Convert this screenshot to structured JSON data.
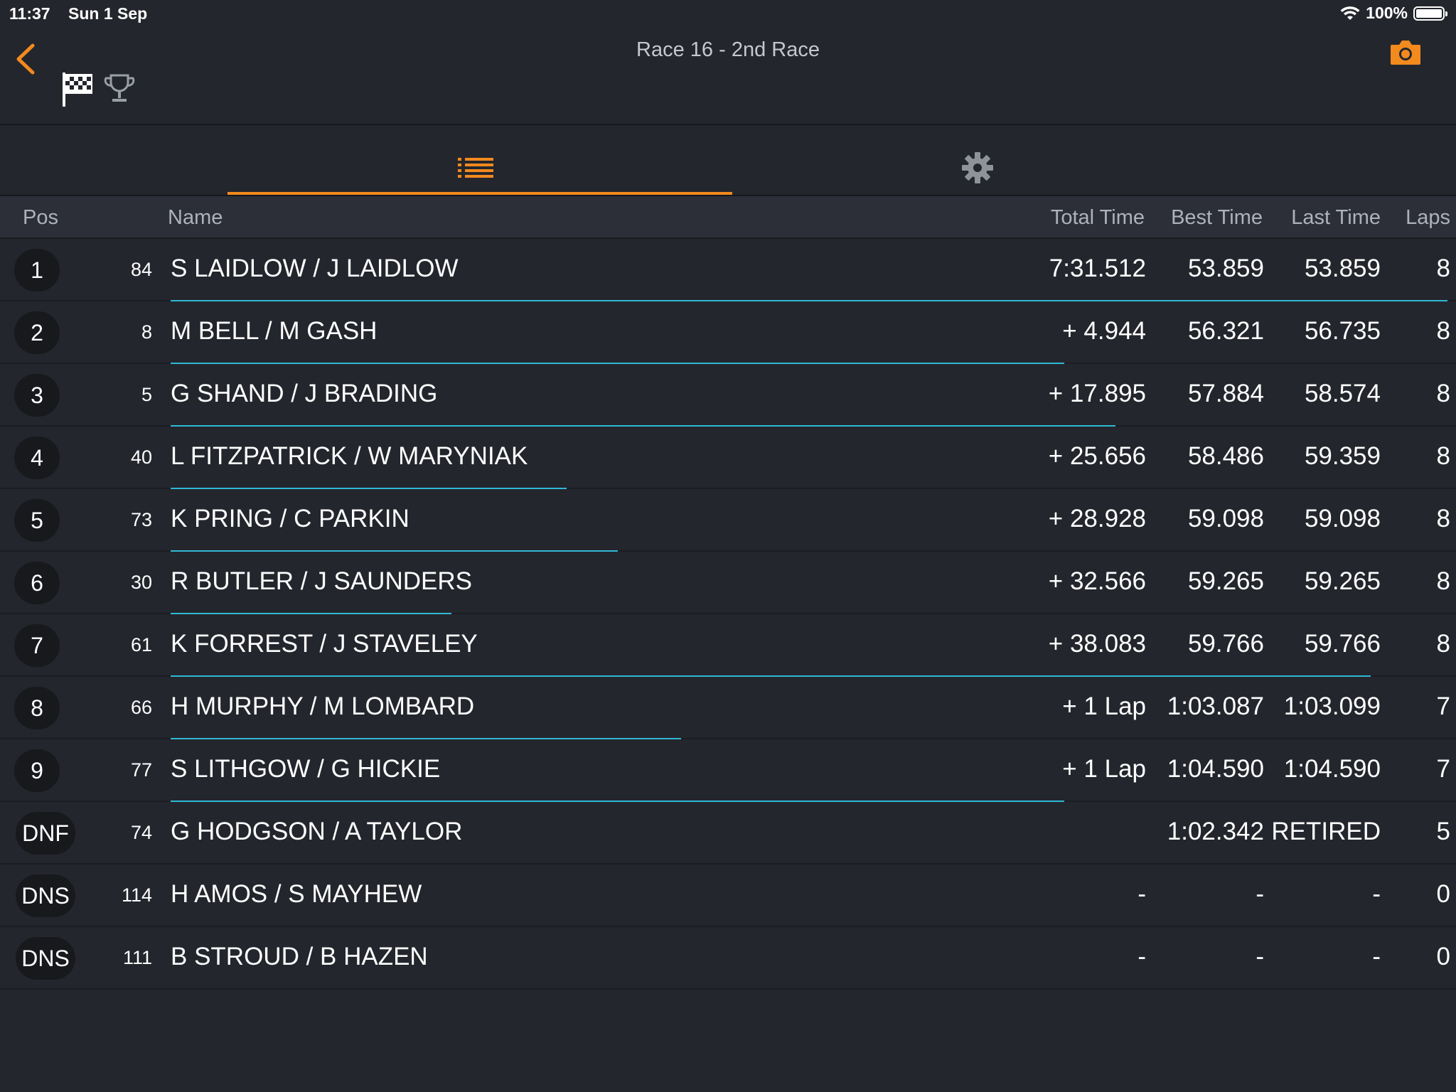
{
  "status": {
    "time": "11:37",
    "date": "Sun 1 Sep",
    "battery": "100%"
  },
  "header": {
    "title": "Race 16 - 2nd Race"
  },
  "colors": {
    "accent": "#f28a1e",
    "bar": "#2fb8d4",
    "background": "#24262d"
  },
  "icons": [
    "back-chevron-icon",
    "checkered-flag-icon",
    "trophy-icon",
    "camera-icon",
    "list-icon",
    "gear-icon",
    "wifi-icon",
    "battery-icon"
  ],
  "columns": {
    "pos": "Pos",
    "name": "Name",
    "total": "Total Time",
    "best": "Best Time",
    "last": "Last Time",
    "laps": "Laps"
  },
  "rows": [
    {
      "pos": "1",
      "num": "84",
      "name": "S LAIDLOW / J LAIDLOW",
      "total": "7:31.512",
      "best": "53.859",
      "last": "53.859",
      "laps": "8",
      "progress": 1.0
    },
    {
      "pos": "2",
      "num": "8",
      "name": "M BELL / M GASH",
      "total": "+ 4.944",
      "best": "56.321",
      "last": "56.735",
      "laps": "8",
      "progress": 0.7
    },
    {
      "pos": "3",
      "num": "5",
      "name": "G SHAND / J BRADING",
      "total": "+ 17.895",
      "best": "57.884",
      "last": "58.574",
      "laps": "8",
      "progress": 0.74
    },
    {
      "pos": "4",
      "num": "40",
      "name": "L FITZPATRICK / W MARYNIAK",
      "total": "+ 25.656",
      "best": "58.486",
      "last": "59.359",
      "laps": "8",
      "progress": 0.31
    },
    {
      "pos": "5",
      "num": "73",
      "name": "K PRING / C PARKIN",
      "total": "+ 28.928",
      "best": "59.098",
      "last": "59.098",
      "laps": "8",
      "progress": 0.35
    },
    {
      "pos": "6",
      "num": "30",
      "name": "R BUTLER / J SAUNDERS",
      "total": "+ 32.566",
      "best": "59.265",
      "last": "59.265",
      "laps": "8",
      "progress": 0.22
    },
    {
      "pos": "7",
      "num": "61",
      "name": "K FORREST / J STAVELEY",
      "total": "+ 38.083",
      "best": "59.766",
      "last": "59.766",
      "laps": "8",
      "progress": 0.94
    },
    {
      "pos": "8",
      "num": "66",
      "name": "H MURPHY / M LOMBARD",
      "total": "+ 1 Lap",
      "best": "1:03.087",
      "last": "1:03.099",
      "laps": "7",
      "progress": 0.4
    },
    {
      "pos": "9",
      "num": "77",
      "name": "S LITHGOW / G HICKIE",
      "total": "+ 1 Lap",
      "best": "1:04.590",
      "last": "1:04.590",
      "laps": "7",
      "progress": 0.7
    },
    {
      "pos": "DNF",
      "num": "74",
      "name": "G HODGSON / A TAYLOR",
      "total": "",
      "best": "1:02.342",
      "last": "RETIRED",
      "laps": "5",
      "progress": 0
    },
    {
      "pos": "DNS",
      "num": "114",
      "name": "H AMOS / S MAYHEW",
      "total": "-",
      "best": "-",
      "last": "-",
      "laps": "0",
      "progress": 0
    },
    {
      "pos": "DNS",
      "num": "111",
      "name": "B STROUD / B HAZEN",
      "total": "-",
      "best": "-",
      "last": "-",
      "laps": "0",
      "progress": 0
    }
  ]
}
